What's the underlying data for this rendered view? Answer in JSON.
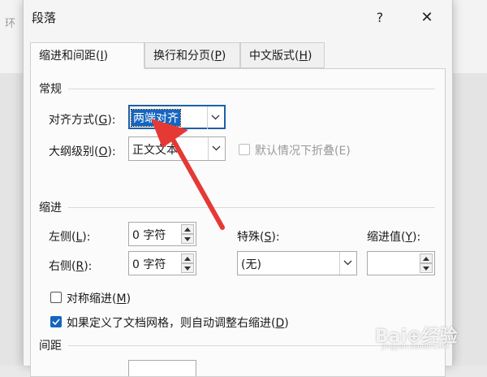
{
  "background": {
    "doc_tab_text": "环",
    "accent": "#1565c0"
  },
  "dialog": {
    "title": "段落",
    "help_label": "?",
    "close_label": "✕"
  },
  "tabs": [
    {
      "label_main": "缩进和间距(",
      "label_key": "I",
      "label_end": ")",
      "active": true
    },
    {
      "label_main": "换行和分页(",
      "label_key": "P",
      "label_end": ")",
      "active": false
    },
    {
      "label_main": "中文版式(",
      "label_key": "H",
      "label_end": ")",
      "active": false
    }
  ],
  "general": {
    "section_title": "常规",
    "alignment": {
      "label_main": "对齐方式(",
      "label_key": "G",
      "label_end": "):",
      "value": "两端对齐"
    },
    "outline": {
      "label_main": "大纲级别(",
      "label_key": "O",
      "label_end": "):",
      "value": "正文文本"
    },
    "collapse": {
      "label_main": "默认情况下折叠(E)",
      "checked": false,
      "disabled": true
    }
  },
  "indent": {
    "section_title": "缩进",
    "left": {
      "label_main": "左侧(",
      "label_key": "L",
      "label_end": "):",
      "value": "0 字符"
    },
    "right": {
      "label_main": "右侧(",
      "label_key": "R",
      "label_end": "):",
      "value": "0 字符"
    },
    "special": {
      "label_main": "特殊(",
      "label_key": "S",
      "label_end": "):",
      "value": "(无)"
    },
    "indent_value": {
      "label_main": "缩进值(",
      "label_key": "Y",
      "label_end": "):",
      "value": ""
    },
    "mirror": {
      "label_main": "对称缩进(",
      "label_key": "M",
      "label_end": ")",
      "checked": false
    },
    "auto_adjust": {
      "label_main": "如果定义了文档网格，则自动调整右缩进(",
      "label_key": "D",
      "label_end": ")",
      "checked": true
    }
  },
  "spacing": {
    "section_title": "间距"
  },
  "watermark": {
    "text": "Bai⊕经验",
    "sub": "jingyan.baidu.com"
  }
}
